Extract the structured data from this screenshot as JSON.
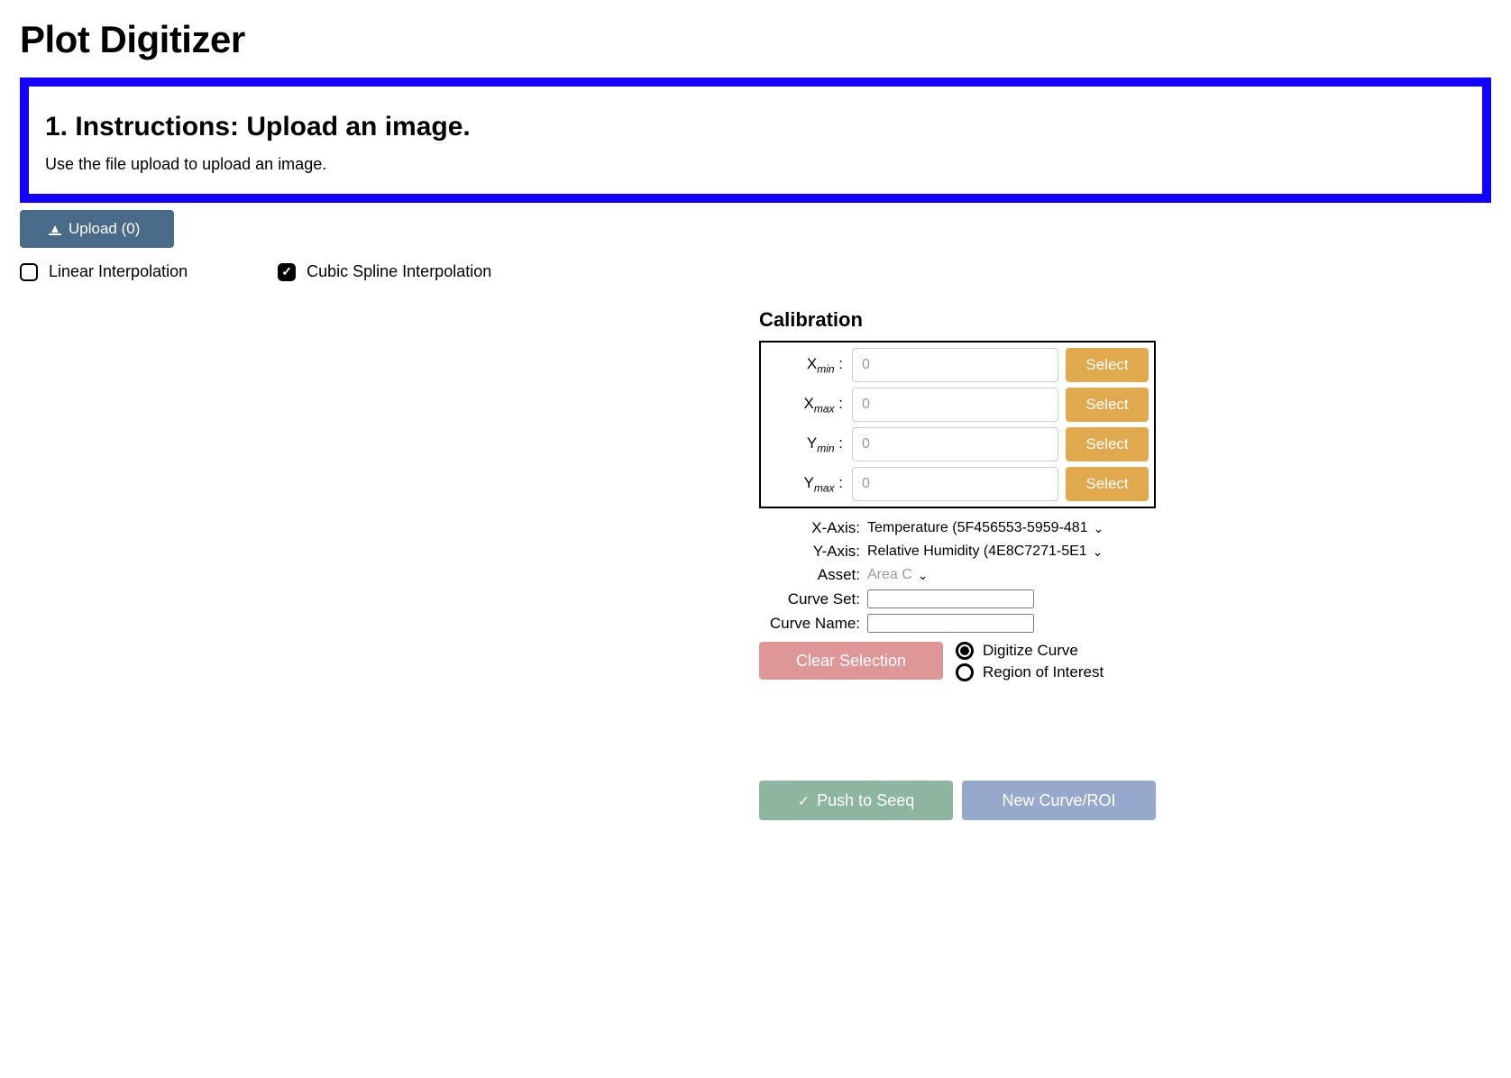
{
  "title": "Plot Digitizer",
  "instructions": {
    "heading": "1. Instructions: Upload an image.",
    "body": "Use the file upload to upload an image."
  },
  "upload": {
    "label": "Upload (0)"
  },
  "interpolation": {
    "linear": {
      "label": "Linear Interpolation",
      "checked": false
    },
    "cubic": {
      "label": "Cubic Spline Interpolation",
      "checked": true
    }
  },
  "calibration": {
    "title": "Calibration",
    "rows": [
      {
        "label_base": "X",
        "label_sub": "min",
        "placeholder": "0",
        "button": "Select"
      },
      {
        "label_base": "X",
        "label_sub": "max",
        "placeholder": "0",
        "button": "Select"
      },
      {
        "label_base": "Y",
        "label_sub": "min",
        "placeholder": "0",
        "button": "Select"
      },
      {
        "label_base": "Y",
        "label_sub": "max",
        "placeholder": "0",
        "button": "Select"
      }
    ]
  },
  "form": {
    "xaxis": {
      "label": "X-Axis:",
      "value": "Temperature (5F456553-5959-481"
    },
    "yaxis": {
      "label": "Y-Axis:",
      "value": "Relative Humidity (4E8C7271-5E1"
    },
    "asset": {
      "label": "Asset:",
      "placeholder": "Area C"
    },
    "curve_set": {
      "label": "Curve Set:",
      "value": ""
    },
    "curve_name": {
      "label": "Curve Name:",
      "value": ""
    }
  },
  "actions": {
    "clear": "Clear Selection",
    "digitize": "Digitize Curve",
    "roi": "Region of Interest",
    "push": "Push to Seeq",
    "newcurve": "New Curve/ROI"
  }
}
